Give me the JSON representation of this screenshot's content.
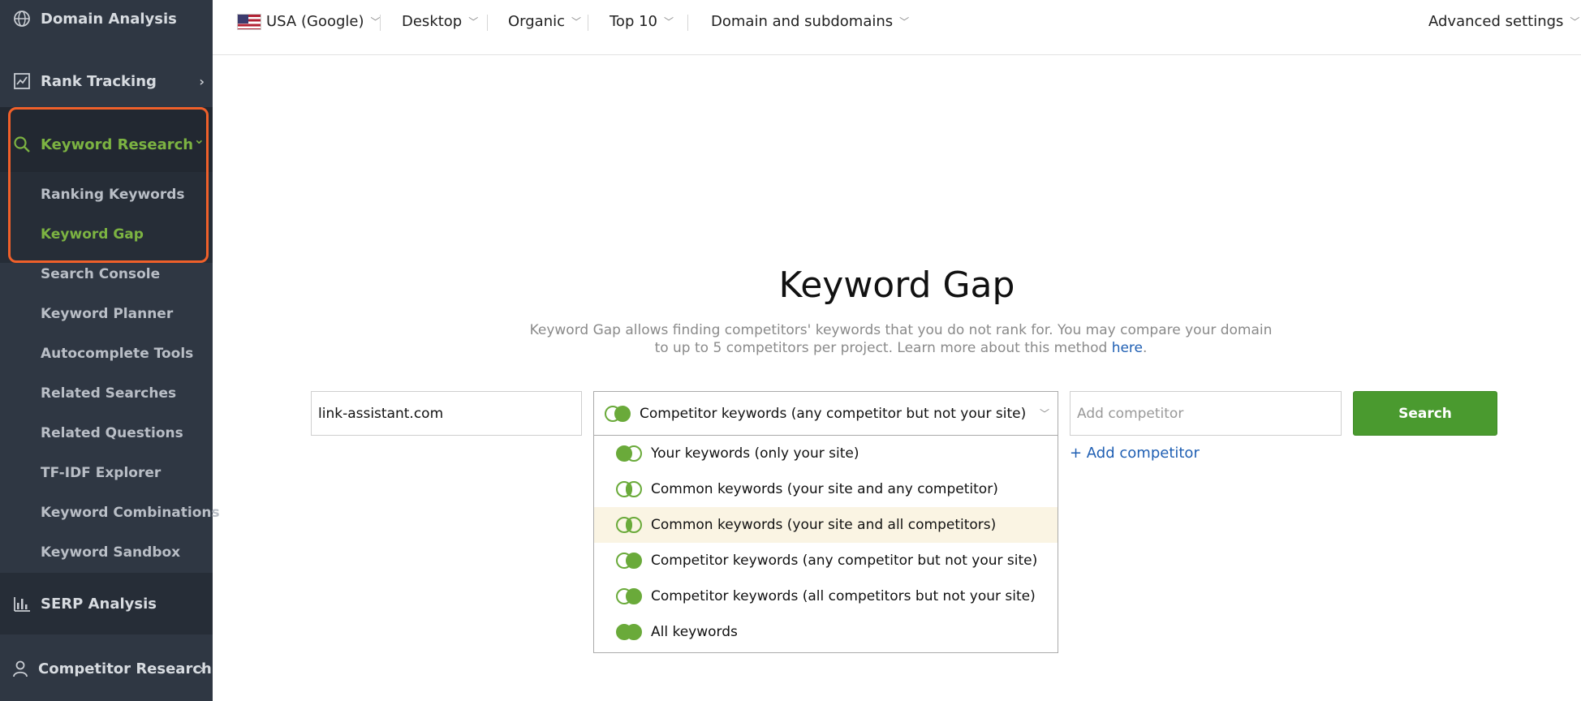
{
  "sidebar": {
    "sections": {
      "domain_analysis": "Domain Analysis",
      "rank_tracking": "Rank Tracking",
      "keyword_research": "Keyword Research",
      "serp_analysis": "SERP Analysis",
      "competitor_research": "Competitor Research"
    },
    "keyword_research_items": [
      {
        "label": "Ranking Keywords",
        "active": false
      },
      {
        "label": "Keyword Gap",
        "active": true
      },
      {
        "label": "Search Console",
        "active": false
      },
      {
        "label": "Keyword Planner",
        "active": false
      },
      {
        "label": "Autocomplete Tools",
        "active": false
      },
      {
        "label": "Related Searches",
        "active": false
      },
      {
        "label": "Related Questions",
        "active": false
      },
      {
        "label": "TF-IDF Explorer",
        "active": false
      },
      {
        "label": "Keyword Combinations",
        "active": false
      },
      {
        "label": "Keyword Sandbox",
        "active": false
      }
    ],
    "chevron_right": "›",
    "chevron_down": "⌄"
  },
  "topbar": {
    "location": "USA (Google)",
    "device": "Desktop",
    "result_type": "Organic",
    "top": "Top 10",
    "scope": "Domain and subdomains",
    "advanced": "Advanced settings",
    "chevron": "﹀"
  },
  "main": {
    "title": "Keyword Gap",
    "description_part1": "Keyword Gap allows finding competitors' keywords that you do not rank for. You may compare your domain to up to 5 competitors per project. Learn more about this method ",
    "description_link": "here",
    "description_end": ".",
    "domain_value": "link-assistant.com",
    "selected_mode": "Competitor keywords (any competitor but not your site)",
    "competitor_placeholder": "Add competitor",
    "search_label": "Search",
    "add_competitor_label": "+ Add competitor",
    "dropdown_options": [
      {
        "label": "Your keywords (only your site)",
        "icon": "venn-left"
      },
      {
        "label": "Common keywords (your site and any competitor)",
        "icon": "venn-mid"
      },
      {
        "label": "Common keywords (your site and all competitors)",
        "icon": "venn-mid"
      },
      {
        "label": "Competitor keywords (any competitor but not your site)",
        "icon": "venn-right"
      },
      {
        "label": "Competitor keywords (all competitors but not your site)",
        "icon": "venn-right"
      },
      {
        "label": "All keywords",
        "icon": "venn-both"
      }
    ]
  },
  "colors": {
    "accent_green": "#7cb342",
    "search_button": "#4a9a2f",
    "highlight_border": "#f0602a",
    "link_blue": "#1f5fb3"
  }
}
